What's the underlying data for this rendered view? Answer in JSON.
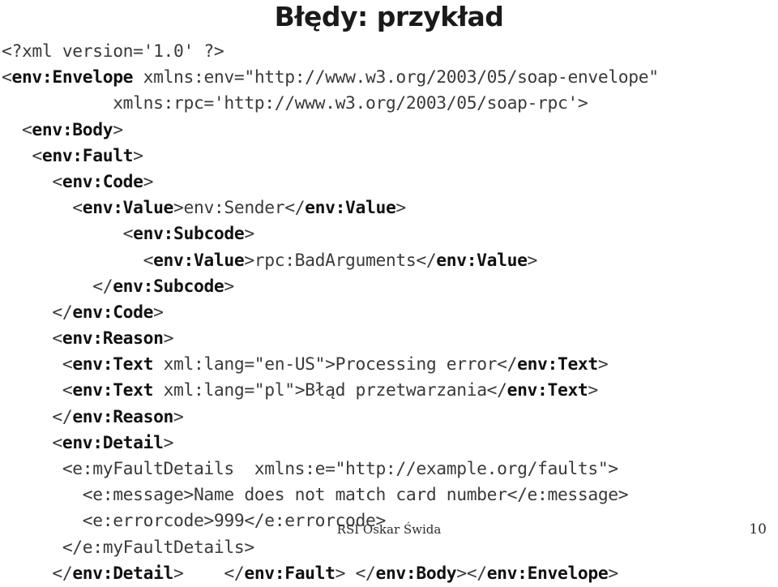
{
  "slide": {
    "title": "Błędy: przykład",
    "background_color": "#ffffff",
    "text_color": "#3a3a3a",
    "tag_color": "#111111"
  },
  "code": {
    "language": "xml",
    "lines": [
      [
        {
          "t": "<?xml version='1.0' ?>",
          "b": false
        }
      ],
      [
        {
          "t": "<",
          "b": false
        },
        {
          "t": "env:Envelope",
          "b": true
        },
        {
          "t": " xmlns:env=\"http://www.w3.org/2003/05/soap-envelope\"",
          "b": false
        }
      ],
      [
        {
          "t": "           xmlns:rpc='http://www.w3.org/2003/05/soap-rpc'>",
          "b": false
        }
      ],
      [
        {
          "t": "  <",
          "b": false
        },
        {
          "t": "env:Body",
          "b": true
        },
        {
          "t": ">",
          "b": false
        }
      ],
      [
        {
          "t": "   <",
          "b": false
        },
        {
          "t": "env:Fault",
          "b": true
        },
        {
          "t": ">",
          "b": false
        }
      ],
      [
        {
          "t": "     <",
          "b": false
        },
        {
          "t": "env:Code",
          "b": true
        },
        {
          "t": ">",
          "b": false
        }
      ],
      [
        {
          "t": "       <",
          "b": false
        },
        {
          "t": "env:Value",
          "b": true
        },
        {
          "t": ">env:Sender</",
          "b": false
        },
        {
          "t": "env:Value",
          "b": true
        },
        {
          "t": ">",
          "b": false
        }
      ],
      [
        {
          "t": "            <",
          "b": false
        },
        {
          "t": "env:Subcode",
          "b": true
        },
        {
          "t": ">",
          "b": false
        }
      ],
      [
        {
          "t": "              <",
          "b": false
        },
        {
          "t": "env:Value",
          "b": true
        },
        {
          "t": ">rpc:BadArguments</",
          "b": false
        },
        {
          "t": "env:Value",
          "b": true
        },
        {
          "t": ">",
          "b": false
        }
      ],
      [
        {
          "t": "         </",
          "b": false
        },
        {
          "t": "env:Subcode",
          "b": true
        },
        {
          "t": ">",
          "b": false
        }
      ],
      [
        {
          "t": "     </",
          "b": false
        },
        {
          "t": "env:Code",
          "b": true
        },
        {
          "t": ">",
          "b": false
        }
      ],
      [
        {
          "t": "     <",
          "b": false
        },
        {
          "t": "env:Reason",
          "b": true
        },
        {
          "t": ">",
          "b": false
        }
      ],
      [
        {
          "t": "      <",
          "b": false
        },
        {
          "t": "env:Text",
          "b": true
        },
        {
          "t": " xml:lang=\"en-US\">Processing error</",
          "b": false
        },
        {
          "t": "env:Text",
          "b": true
        },
        {
          "t": ">",
          "b": false
        }
      ],
      [
        {
          "t": "      <",
          "b": false
        },
        {
          "t": "env:Text",
          "b": true
        },
        {
          "t": " xml:lang=\"pl\">Błąd przetwarzania</",
          "b": false
        },
        {
          "t": "env:Text",
          "b": true
        },
        {
          "t": ">",
          "b": false
        }
      ],
      [
        {
          "t": "     </",
          "b": false
        },
        {
          "t": "env:Reason",
          "b": true
        },
        {
          "t": ">",
          "b": false
        }
      ],
      [
        {
          "t": "     <",
          "b": false
        },
        {
          "t": "env:Detail",
          "b": true
        },
        {
          "t": ">",
          "b": false
        }
      ],
      [
        {
          "t": "      <e:myFaultDetails  xmlns:e=\"http://example.org/faults\">",
          "b": false
        }
      ],
      [
        {
          "t": "        <e:message>Name does not match card number</e:message>",
          "b": false
        }
      ],
      [
        {
          "t": "        <e:errorcode>999</e:errorcode>",
          "b": false
        }
      ],
      [
        {
          "t": "      </e:myFaultDetails>",
          "b": false
        }
      ],
      [
        {
          "t": "     </",
          "b": false
        },
        {
          "t": "env:Detail",
          "b": true
        },
        {
          "t": ">    </",
          "b": false
        },
        {
          "t": "env:Fault",
          "b": true
        },
        {
          "t": "> </",
          "b": false
        },
        {
          "t": "env:Body",
          "b": true
        },
        {
          "t": "></",
          "b": false
        },
        {
          "t": "env:Envelope",
          "b": true
        },
        {
          "t": ">",
          "b": false
        }
      ]
    ]
  },
  "footer": {
    "author": "RSI Oskar Świda",
    "page_number": "10"
  }
}
